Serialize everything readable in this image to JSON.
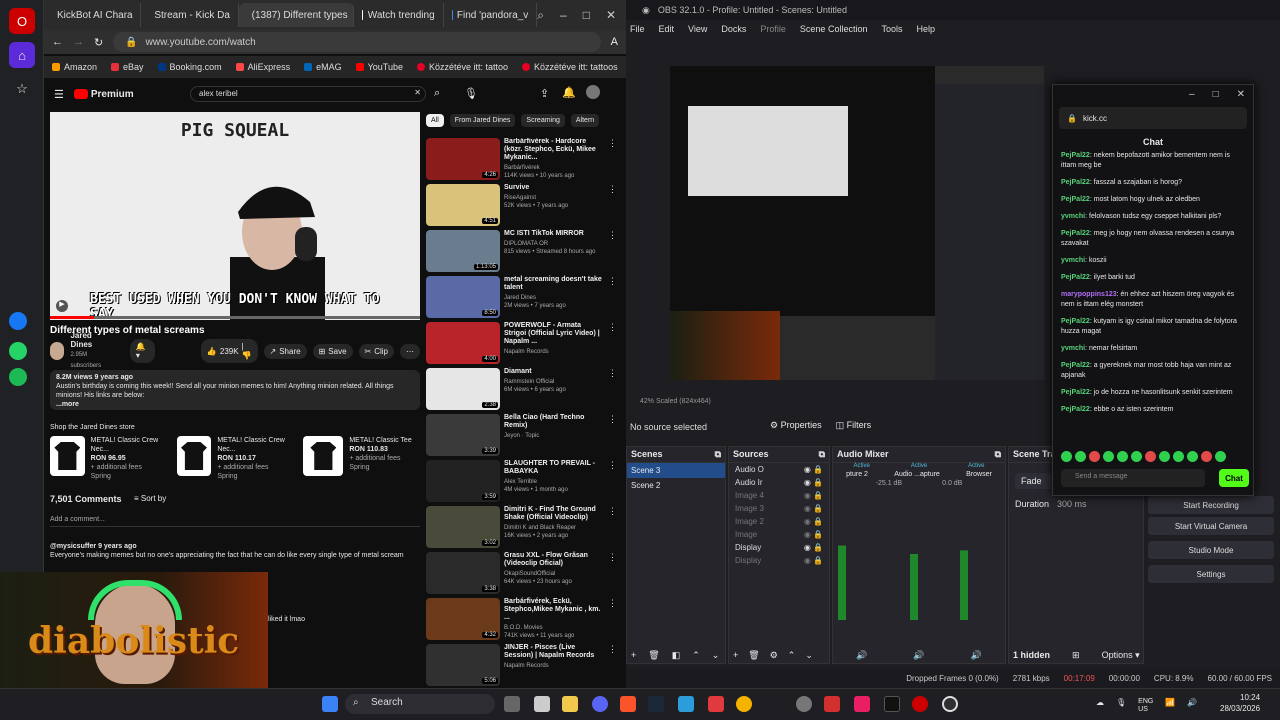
{
  "browser": {
    "tabs": [
      "KickBot AI Chara",
      "Stream - Kick Da",
      "(1387) Different types",
      "Watch trending",
      "Find 'pandora_v"
    ],
    "active_tab": 2,
    "url": "www.youtube.com/watch",
    "bookmarks": [
      {
        "label": "Amazon",
        "color": "#ff9900"
      },
      {
        "label": "eBay",
        "color": "#e53238"
      },
      {
        "label": "Booking.com",
        "color": "#003580"
      },
      {
        "label": "AliExpress",
        "color": "#ff4747"
      },
      {
        "label": "eMAG",
        "color": "#0067b8"
      },
      {
        "label": "YouTube",
        "color": "#ff0000"
      },
      {
        "label": "Közzétéve itt: tattoo",
        "color": "#e60023"
      },
      {
        "label": "Közzétéve itt: tattoos",
        "color": "#e60023"
      }
    ]
  },
  "youtube": {
    "logo": "Premium",
    "search": "alex teribel",
    "video_title_overlay": "PIG SQUEAL",
    "caption": "BEST USED WHEN YOU DON'T KNOW WHAT TO SAY",
    "title": "Different types of metal screams",
    "channel": "Jared Dines",
    "subs": "2.95M subscribers",
    "likes": "239K",
    "share": "Share",
    "save": "Save",
    "clip": "Clip",
    "desc_meta": "8.2M views 9 years ago",
    "desc": "Austin's birthday is coming this week!! Send all your minion memes to him! Anything minion related. All things minions! His links are below:",
    "more": "...more",
    "store_title": "Shop the Jared Dines store",
    "store": [
      {
        "name": "METAL! Classic Crew Nec...",
        "price": "RON 96.95",
        "fees": "+ additional fees",
        "tag": "Spring"
      },
      {
        "name": "METAL! Classic Crew Nec...",
        "price": "RON 110.17",
        "fees": "+ additional fees",
        "tag": "Spring"
      },
      {
        "name": "METAL! Classic Tee",
        "price": "RON 110.83",
        "fees": "+ additional fees",
        "tag": "Spring"
      }
    ],
    "comments_count": "7,501 Comments",
    "sort": "Sort by",
    "add_comment": "Add a comment...",
    "comment_user": "@mysicsuffer 9 years ago",
    "comment_text": "Everyone's making memes but no one's appreciating the fact that he can do like every single type of metal scream",
    "liked": "liked it lmao",
    "chips": [
      "All",
      "From Jared Dines",
      "Screaming",
      "Altern"
    ],
    "recs": [
      {
        "title": "Barbárfivérek - Hardcore (közr. Stephco, Eckü, Mikee Mykanic...",
        "ch": "Barbárfivérek",
        "meta": "114K views • 10 years ago",
        "dur": "4:26",
        "color": "#8a1c1c"
      },
      {
        "title": "Survive",
        "ch": "RiseAgainst",
        "meta": "52K views • 7 years ago",
        "dur": "4:51",
        "color": "#d9c27a"
      },
      {
        "title": "MC ISTI TikTok MIRROR",
        "ch": "DIPLOMATA OR",
        "meta": "815 views • Streamed 8 hours ago",
        "dur": "1:13:05",
        "color": "#6a7d8e"
      },
      {
        "title": "metal screaming doesn't take talent",
        "ch": "Jared Dines",
        "meta": "2M views • 7 years ago",
        "dur": "8:50",
        "color": "#5a6aa6"
      },
      {
        "title": "POWERWOLF - Armata Strigoi (Official Lyric Video) | Napalm ...",
        "ch": "Napalm Records",
        "meta": "",
        "dur": "4:00",
        "color": "#b8242a"
      },
      {
        "title": "Diamant",
        "ch": "Rammstein Official",
        "meta": "6M views • 6 years ago",
        "dur": "2:38",
        "color": "#e6e6e6"
      },
      {
        "title": "Bella Ciao (Hard Techno Remix)",
        "ch": "Jeyon · Topic",
        "meta": "",
        "dur": "3:39",
        "color": "#3a3a3a"
      },
      {
        "title": "SLAUGHTER TO PREVAIL - BABAYKA",
        "ch": "Alex Terrible",
        "meta": "4M views • 1 month ago",
        "dur": "3:59",
        "color": "#222"
      },
      {
        "title": "Dimitri K - Find The Ground Shake (Official Videoclip)",
        "ch": "Dimitri K and Black Reaper",
        "meta": "16K views • 2 years ago",
        "dur": "3:02",
        "color": "#4a4a3a"
      },
      {
        "title": "Grasu XXL - Flow Grăsan (Videoclip Oficial)",
        "ch": "OkapiSoundOfficial",
        "meta": "64K views • 23 hours ago",
        "dur": "3:38",
        "color": "#2a2a2a"
      },
      {
        "title": "Barbárfivérek, Eckü, Stephco,Mikee Mykanic , km. ...",
        "ch": "B.O.D. Movies",
        "meta": "741K views • 11 years ago",
        "dur": "4:32",
        "color": "#6a3a1a"
      },
      {
        "title": "JINJER - Pisces (Live Session) | Napalm Records",
        "ch": "Napalm Records",
        "meta": "",
        "dur": "5:06",
        "color": "#303030"
      }
    ],
    "webcam_text": "diabolistic"
  },
  "obs": {
    "title": "OBS 32.1.0 - Profile: Untitled - Scenes: Untitled",
    "menu": [
      "File",
      "Edit",
      "View",
      "Docks",
      "Profile",
      "Scene Collection",
      "Tools",
      "Help"
    ],
    "scale_info": "42%    Scaled (824x464)",
    "no_source": "No source selected",
    "properties": "Properties",
    "filters": "Filters",
    "panels": {
      "scenes": "Scenes",
      "sources": "Sources",
      "mixer": "Audio Mixer",
      "transitions": "Scene Tra"
    },
    "scenes": [
      "Scene 3",
      "Scene 2"
    ],
    "sources": [
      {
        "name": "Audio O",
        "dim": false
      },
      {
        "name": "Audio Ir",
        "dim": false
      },
      {
        "name": "Image 4",
        "dim": true
      },
      {
        "name": "Image 3",
        "dim": true
      },
      {
        "name": "Image 2",
        "dim": true
      },
      {
        "name": "Image",
        "dim": true
      },
      {
        "name": "Display",
        "dim": false
      },
      {
        "name": "Display",
        "dim": true
      }
    ],
    "mixer_labels": [
      "pture 2",
      "Audio ...apture",
      "Browser"
    ],
    "mixer_status": [
      "Active",
      "Active",
      "Active"
    ],
    "mixer_db": [
      "-25.1 dB",
      "0.0 dB"
    ],
    "mixer_levels": [
      0.62,
      0.55,
      0.58
    ],
    "transition": "Fade",
    "duration_label": "Duration",
    "duration": "300 ms",
    "hidden": "1 hidden",
    "options": "Options",
    "controls": [
      "Start Recording",
      "Start Virtual Camera",
      "Studio Mode",
      "Settings"
    ],
    "status": {
      "dropped": "Dropped Frames 0 (0.0%)",
      "bitrate": "2781 kbps",
      "stream_time": "00:17:09",
      "rec_time": "00:00:00",
      "cpu": "CPU: 8.9%",
      "fps": "60.00 / 60.00 FPS"
    }
  },
  "kick": {
    "url": "kick.cc",
    "chat_title": "Chat",
    "messages": [
      {
        "user": "PejPal22",
        "text": "nekem bepofazott amikor bementem nem is ittam meg be"
      },
      {
        "user": "PejPal22",
        "text": "fasszal a szajaban is horog?"
      },
      {
        "user": "PejPal22",
        "text": "most latom hogy ulnek az oledben"
      },
      {
        "user": "yvmchi",
        "text": "felolvason tudsz egy cseppet halkitani pls?"
      },
      {
        "user": "PejPal22",
        "text": "meg jo hogy nem olvassa rendesen a csunya szavakat"
      },
      {
        "user": "yvmchi",
        "text": "koszii"
      },
      {
        "user": "PejPal22",
        "text": "ilyet barki tud"
      },
      {
        "user": "marypoppins123",
        "text": "én ehhez azt hiszem öreg vagyok és nem is ittam elég monstert"
      },
      {
        "user": "PejPal22",
        "text": "kutyam is igy csinal mikor tamadna de folytora huzza magat"
      },
      {
        "user": "yvmchi",
        "text": "nemar felsirtam"
      },
      {
        "user": "PejPal22",
        "text": "a gyereknek mar most tobb haja van mint az apjanak"
      },
      {
        "user": "PejPal22",
        "text": "jo de hozza ne hasonlitsunk senkit szerintem"
      },
      {
        "user": "PejPal22",
        "text": "ebbe o az isten szerintem"
      }
    ],
    "placeholder": "Send a message",
    "send": "Chat"
  },
  "taskbar": {
    "search": "Search",
    "lang": "ENG",
    "region": "US",
    "time": "10:24",
    "date": "28/03/2026"
  }
}
